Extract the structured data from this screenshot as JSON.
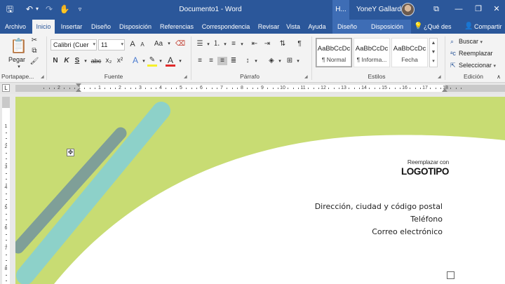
{
  "window": {
    "title": "Documento1  -  Word",
    "context_tab_short": "H...",
    "user_name": "YoneY Gallardo",
    "icons": [
      "save-icon",
      "undo-icon",
      "redo-icon",
      "touch-mode-icon",
      "customize-toolbar-icon",
      "ribbon-display-options-icon",
      "minimize-icon",
      "restore-icon",
      "close-icon"
    ],
    "glyphs": {
      "save": "🖫",
      "undo": "↶",
      "undo_dd": "▾",
      "redo": "↷",
      "touch": "✋",
      "qat_dd": "▿",
      "ribbon_opts": "⧉",
      "minimize": "—",
      "restore": "❐",
      "close": "✕"
    }
  },
  "tabs": [
    {
      "label": "Archivo"
    },
    {
      "label": "Inicio",
      "active": true
    },
    {
      "label": "Insertar"
    },
    {
      "label": "Diseño"
    },
    {
      "label": "Disposición"
    },
    {
      "label": "Referencias"
    },
    {
      "label": "Correspondencia"
    },
    {
      "label": "Revisar"
    },
    {
      "label": "Vista"
    },
    {
      "label": "Ayuda"
    },
    {
      "label": "Diseño",
      "contextual": true
    },
    {
      "label": "Disposición",
      "contextual": true
    }
  ],
  "tell_me": {
    "icon": "lightbulb-icon",
    "glyph": "💡",
    "label": "¿Qué des"
  },
  "share": {
    "icon": "person-icon",
    "glyph": "👤",
    "label": "Compartir"
  },
  "ribbon": {
    "clipboard": {
      "group_label": "Portapape...",
      "paste_label": "Pegar",
      "glyphs": {
        "paste": "📋",
        "cut": "✂",
        "copy": "⧉",
        "format_painter": "🖌",
        "dropdown": "▾"
      }
    },
    "font": {
      "group_label": "Fuente",
      "font_name": "Calibri (Cuer",
      "font_size": "11",
      "glyphs": {
        "grow": "A",
        "shrink": "A",
        "change_case": "Aa",
        "clear_format": "⌫",
        "bold": "N",
        "italic": "K",
        "underline": "S",
        "strike": "abc",
        "subscript": "x₂",
        "superscript": "x²",
        "text_effects": "A",
        "highlight": "✎",
        "font_color": "A",
        "launcher": "◢",
        "dropdown": "▾"
      }
    },
    "paragraph": {
      "group_label": "Párrafo",
      "glyphs": {
        "bullets": "☰",
        "numbering": "⒈",
        "multilevel": "≡",
        "decrease_indent": "⇤",
        "increase_indent": "⇥",
        "sort": "⇅",
        "pilcrow": "¶",
        "align_left": "≡",
        "center": "≡",
        "align_right": "≡",
        "justify": "≣",
        "line_spacing": "↕",
        "shading": "◈",
        "borders": "⊞",
        "launcher": "◢",
        "dropdown": "▾"
      }
    },
    "styles": {
      "group_label": "Estilos",
      "items": [
        {
          "sample": "AaBbCcDc",
          "name": "¶ Normal",
          "selected": true
        },
        {
          "sample": "AaBbCcDc",
          "name": "¶ Informa..."
        },
        {
          "sample": "AaBbCcDc",
          "name": "Fecha"
        }
      ],
      "scroll_glyphs": {
        "up": "▲",
        "down": "▼",
        "more": "▾"
      },
      "launcher": "◢"
    },
    "editing": {
      "group_label": "Edición",
      "find_label": "Buscar",
      "replace_label": "Reemplazar",
      "select_label": "Seleccionar",
      "glyphs": {
        "find": "⌕",
        "replace": "ᵃc",
        "select": "⇱",
        "dropdown": "▾",
        "collapse": "∧"
      }
    }
  },
  "ruler": {
    "corner": "L",
    "h_numbers": [
      "2",
      "1",
      "1",
      "2",
      "3",
      "4",
      "5",
      "6",
      "7",
      "8",
      "9",
      "10",
      "11",
      "12",
      "13",
      "14",
      "15",
      "16",
      "17",
      "18"
    ],
    "v_numbers": [
      "1",
      "2",
      "3",
      "4",
      "5",
      "6",
      "7",
      "8"
    ]
  },
  "document": {
    "move_handle_glyph": "✥",
    "logo_small": "Reemplazar con",
    "logo_big": "LOGOTIPO",
    "contact": [
      "Dirección, ciudad y código postal",
      "Teléfono",
      "Correo electrónico"
    ],
    "colors": {
      "lime": "#c8dc73",
      "teal": "#8dd1c9",
      "dark_teal": "#7f9f98",
      "page": "#ffffff"
    }
  }
}
